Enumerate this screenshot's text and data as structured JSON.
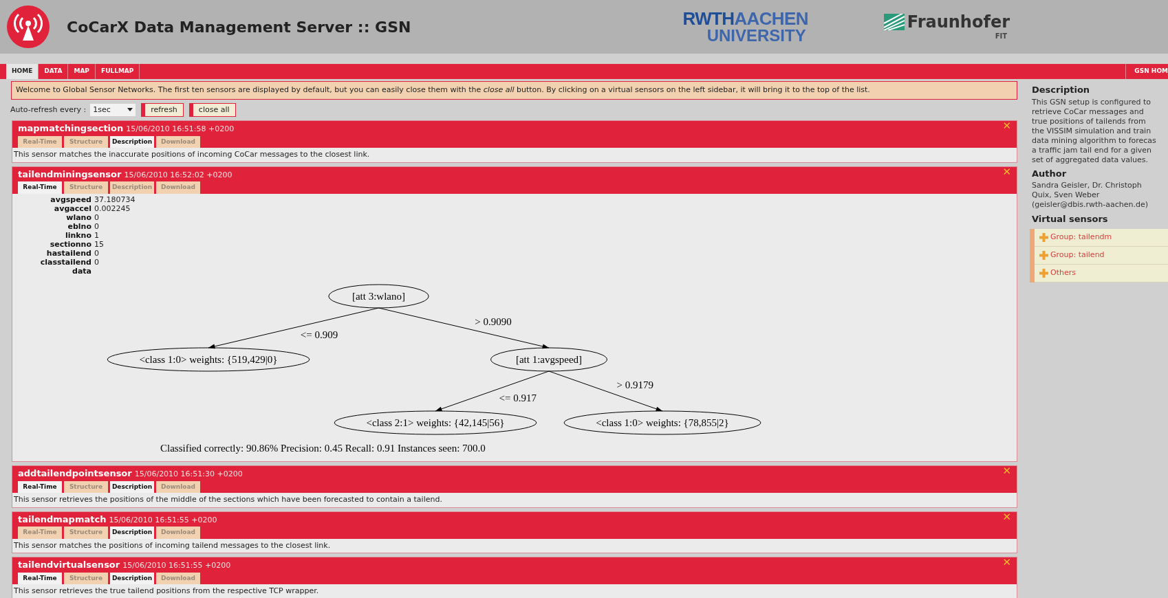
{
  "header": {
    "title": "CoCarX Data Management Server :: GSN",
    "logos": [
      {
        "kind": "rwth",
        "main": "RWTH",
        "accent": "AACHEN",
        "sub": "UNIVERSITY"
      },
      {
        "kind": "fraunhofer",
        "main": "Fraunhofer",
        "sub": "FIT"
      }
    ]
  },
  "nav": {
    "tabs": [
      {
        "label": "HOME",
        "selected": true
      },
      {
        "label": "DATA",
        "selected": false
      },
      {
        "label": "MAP",
        "selected": false
      },
      {
        "label": "FULLMAP",
        "selected": false
      }
    ],
    "right": "GSN HOM"
  },
  "welcome": "Welcome to Global Sensor Networks. The first ten sensors are displayed by default, but you can easily close them with the *close all* button. By clicking on a virtual sensors on the left sidebar, it will bring it to the top of the list.",
  "controls": {
    "label": "Auto-refresh every :",
    "select": "1sec",
    "buttons": [
      "refresh",
      "close all"
    ]
  },
  "sensors": [
    {
      "name": "mapmatchingsection",
      "time": "15/06/2010 16:51:58 +0200",
      "close": "✕",
      "tabs": [
        {
          "label": "Real-Time",
          "selected": false
        },
        {
          "label": "Structure",
          "selected": false
        },
        {
          "label": "Description",
          "selected": true
        },
        {
          "label": "Download",
          "selected": false
        }
      ],
      "kind": "description",
      "text": "This sensor matches the inaccurate positions of incoming CoCar messages to the closest link."
    },
    {
      "name": "tailendminingsensor",
      "time": "15/06/2010 16:52:02 +0200",
      "close": "✕",
      "tabs": [
        {
          "label": "Real-Time",
          "selected": true
        },
        {
          "label": "Structure",
          "selected": false
        },
        {
          "label": "Description",
          "selected": false
        },
        {
          "label": "Download",
          "selected": false
        }
      ],
      "kind": "realtime",
      "fields": [
        {
          "name": "avgspeed",
          "value": "37.180734"
        },
        {
          "name": "avgaccel",
          "value": "0.002245"
        },
        {
          "name": "wlano",
          "value": "0"
        },
        {
          "name": "eblno",
          "value": "0"
        },
        {
          "name": "linkno",
          "value": "1"
        },
        {
          "name": "sectionno",
          "value": "15"
        },
        {
          "name": "hastailend",
          "value": "0"
        },
        {
          "name": "classtailend",
          "value": "0"
        },
        {
          "name": "data"
        }
      ],
      "tree": {
        "label": "[att 3:wlano]",
        "children": [
          {
            "edge": "<= 0.909",
            "label": "<class 1:0> weights: {519,429|0}"
          },
          {
            "edge": "> 0.9090",
            "label": "[att 1:avgspeed]",
            "children": [
              {
                "edge": "<= 0.917",
                "label": "<class 2:1> weights: {42,145|56}"
              },
              {
                "edge": "> 0.9179",
                "label": "<class 1:0> weights: {78,855|2}"
              }
            ]
          }
        ]
      },
      "summary": "Classified correctly: 90.86% Precision: 0.45 Recall: 0.91 Instances seen: 700.0"
    },
    {
      "name": "addtailendpointsensor",
      "time": "15/06/2010 16:51:30 +0200",
      "close": "✕",
      "tabs": [
        {
          "label": "Real-Time",
          "selected": true
        },
        {
          "label": "Structure",
          "selected": false
        },
        {
          "label": "Description",
          "selected": true
        },
        {
          "label": "Download",
          "selected": false
        }
      ],
      "kind": "description",
      "text": "This sensor retrieves the positions of the middle of the sections which have been forecasted to contain a tailend."
    },
    {
      "name": "tailendmapmatch",
      "time": "15/06/2010 16:51:55 +0200",
      "close": "✕",
      "tabs": [
        {
          "label": "Real-Time",
          "selected": false
        },
        {
          "label": "Structure",
          "selected": false
        },
        {
          "label": "Description",
          "selected": true
        },
        {
          "label": "Download",
          "selected": false
        }
      ],
      "kind": "description",
      "text": "This sensor matches the positions of incoming tailend messages to the closest link."
    },
    {
      "name": "tailendvirtualsensor",
      "time": "15/06/2010 16:51:55 +0200",
      "close": "✕",
      "tabs": [
        {
          "label": "Real-Time",
          "selected": true
        },
        {
          "label": "Structure",
          "selected": false
        },
        {
          "label": "Description",
          "selected": true
        },
        {
          "label": "Download",
          "selected": false
        }
      ],
      "kind": "description",
      "text": "This sensor retrieves the true tailend positions from the respective TCP wrapper."
    }
  ],
  "sidebar": {
    "description_title": "Description",
    "description_lines": [
      "This GSN setup is configured to",
      "retrieve CoCar messages and",
      "true positions of tailends from",
      "the VISSIM simulation and train",
      "data mining algorithm to forecas",
      "a traffic jam tail end for a given",
      "set of aggregated data values."
    ],
    "author_title": "Author",
    "author_lines": [
      "Sandra Geisler, Dr. Christoph",
      "Quix, Sven Weber",
      "(geisler@dbis.rwth-aachen.de)"
    ],
    "sensors_title": "Virtual sensors",
    "groups": [
      "Group: tailendm",
      "Group: tailend",
      "Others"
    ]
  }
}
